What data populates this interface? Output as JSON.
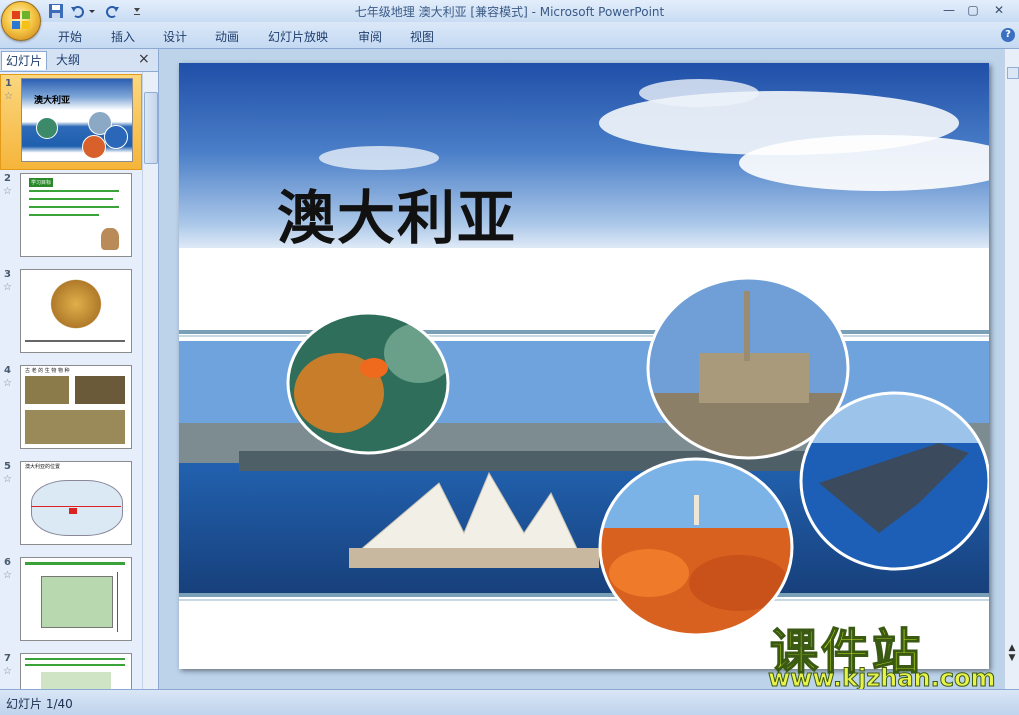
{
  "titlebar": {
    "title": "七年级地理 澳大利亚 [兼容模式] - Microsoft PowerPoint"
  },
  "ribbon": {
    "tabs": [
      "开始",
      "插入",
      "设计",
      "动画",
      "幻灯片放映",
      "审阅",
      "视图"
    ],
    "help": "?"
  },
  "panel": {
    "tabs": {
      "slides": "幻灯片",
      "outline": "大纲"
    },
    "close": "×",
    "thumbnails": [
      {
        "num": "1",
        "title": "澳大利亚"
      },
      {
        "num": "2",
        "title": "学习目标"
      },
      {
        "num": "3",
        "title": ""
      },
      {
        "num": "4",
        "title": "古 老 的 生 物 物 种"
      },
      {
        "num": "5",
        "title": "澳大利亚的位置"
      },
      {
        "num": "6",
        "title": ""
      },
      {
        "num": "7",
        "title": ""
      }
    ]
  },
  "slide": {
    "title": "澳大利亚"
  },
  "watermark": {
    "cn": "课件站",
    "url": "www.kjzhan.com"
  },
  "status": {
    "text": "幻灯片 1/40"
  },
  "colors": {
    "ribbon": "#c4d9f2",
    "selected": "#f5b53b",
    "sky": "#2e62b6",
    "sea": "#1e5fae"
  }
}
